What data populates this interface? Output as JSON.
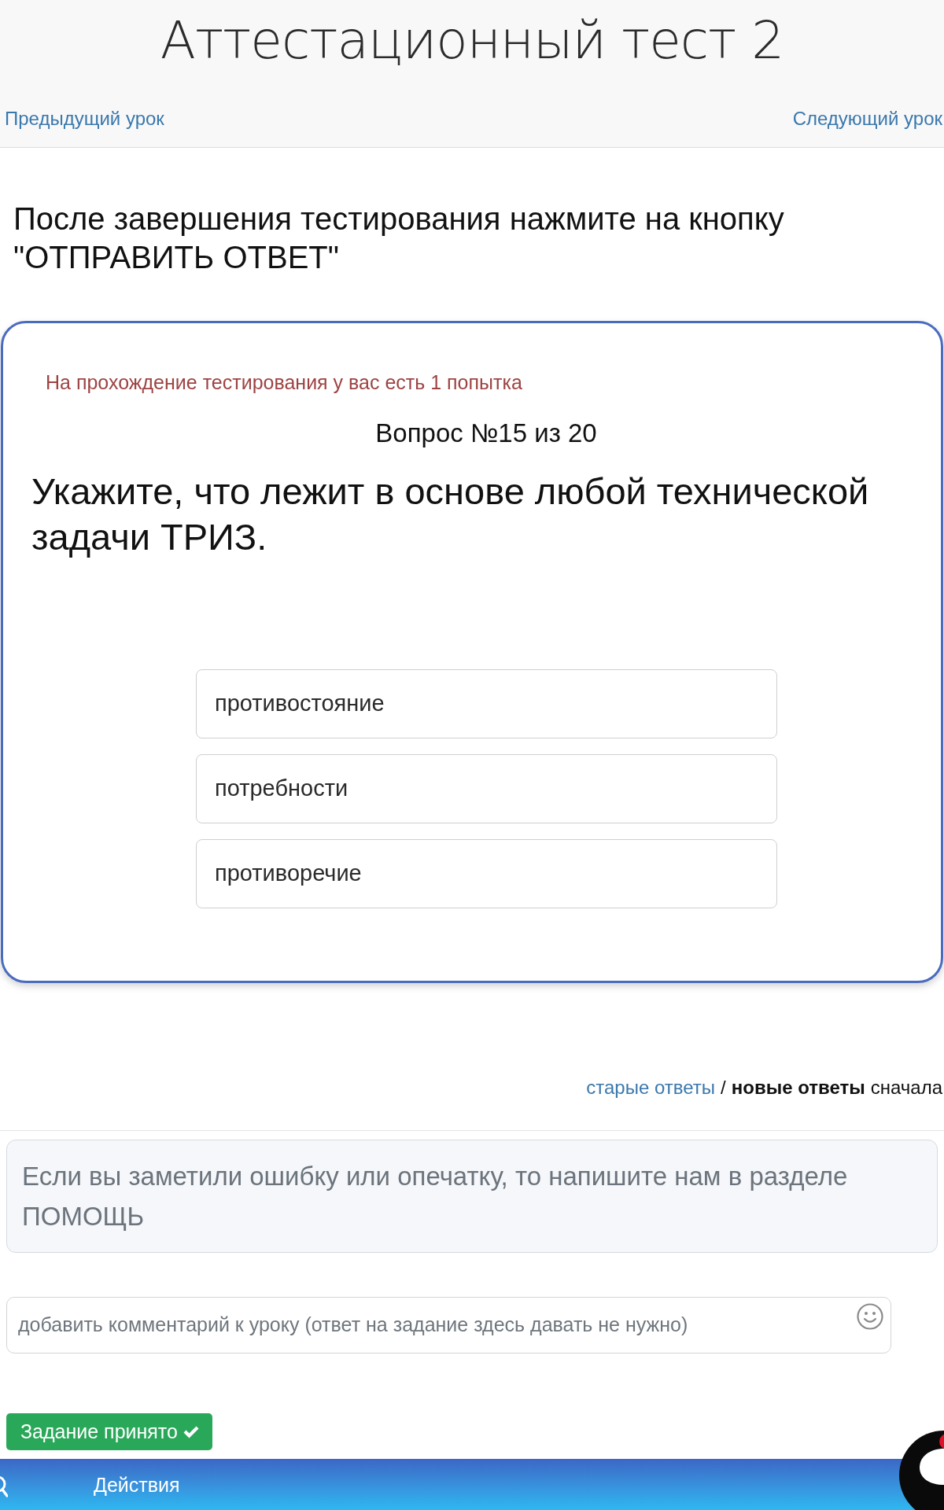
{
  "page": {
    "title": "Аттестационный тест 2"
  },
  "lesson_nav": {
    "previous": "Предыдущий урок",
    "next": "Следующий урок"
  },
  "instruction": "После завершения тестирования нажмите на кнопку \"ОТПРАВИТЬ ОТВЕТ\"",
  "test_card": {
    "attempts_note": "На прохождение тестирования у вас есть 1 попытка",
    "question_counter": "Вопрос №15 из 20",
    "question": "Укажите, что лежит в основе любой технической задачи ТРИЗ.",
    "options": [
      {
        "label": "противостояние",
        "selected": false
      },
      {
        "label": "потребности",
        "selected": false
      },
      {
        "label": "противоречие",
        "selected": false
      }
    ]
  },
  "comment_sort": {
    "options": [
      {
        "label": "старые ответы",
        "selected": false
      },
      {
        "label": "новые ответы",
        "selected": true
      }
    ],
    "separator": "/",
    "suffix": "сначала"
  },
  "notice": "Если вы заметили ошибку или опечатку, то напишите нам в разделе ПОМОЩЬ",
  "comment_field": {
    "placeholder": "добавить комментарий к уроку (ответ на задание здесь давать не нужно)"
  },
  "task_status": {
    "label": "Задание принято"
  },
  "bottom_bar": {
    "actions_label": "Действия"
  }
}
